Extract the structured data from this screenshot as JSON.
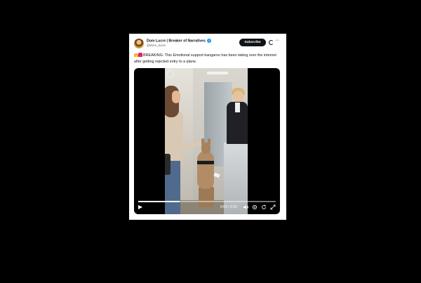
{
  "tweet": {
    "author_name": "Dom Lucre | Breaker of Narratives",
    "handle": "@dom_lucre",
    "subscribe_label": "Subscribe",
    "more_label": "···",
    "text": "BREAKING: This Emotional support kangaroo has been taking over the internet after getting rejected entry to a plane."
  },
  "video": {
    "time_label": "0:03 / 0:10",
    "progress": 0.3
  },
  "icons": [
    "verified-badge-icon",
    "grok-icon",
    "more-icon",
    "fire-emoji-icon",
    "siren-emoji-icon",
    "play-icon",
    "volume-icon",
    "settings-icon",
    "loop-icon",
    "fullscreen-icon"
  ],
  "colors": {
    "accent": "#1d9bf0",
    "text": "#0f1419",
    "muted": "#536471",
    "background": "#000000"
  }
}
